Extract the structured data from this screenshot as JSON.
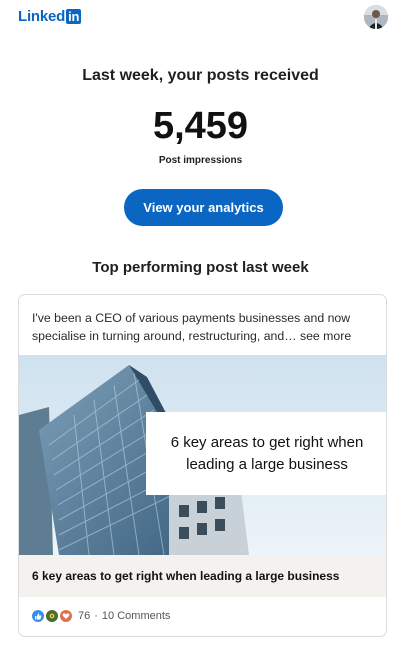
{
  "brand": {
    "name_text": "Linked",
    "name_in": "in",
    "color": "#0a66c2"
  },
  "summary": {
    "title": "Last week, your posts received",
    "impressions": "5,459",
    "impressions_label": "Post impressions",
    "button_label": "View your analytics"
  },
  "top_post": {
    "heading": "Top performing post last week",
    "text": "I've been a CEO of various payments businesses and now specialise in turning around, restructuring, and… see more",
    "overlay_line1": "6 key areas to get right when",
    "overlay_line2": "leading a large business",
    "caption": "6 key areas to get right when leading a large business",
    "reaction_count": "76",
    "separator": "·",
    "comments": "10 Comments",
    "reaction_icons": [
      "like-icon",
      "celebrate-icon",
      "love-icon"
    ]
  }
}
